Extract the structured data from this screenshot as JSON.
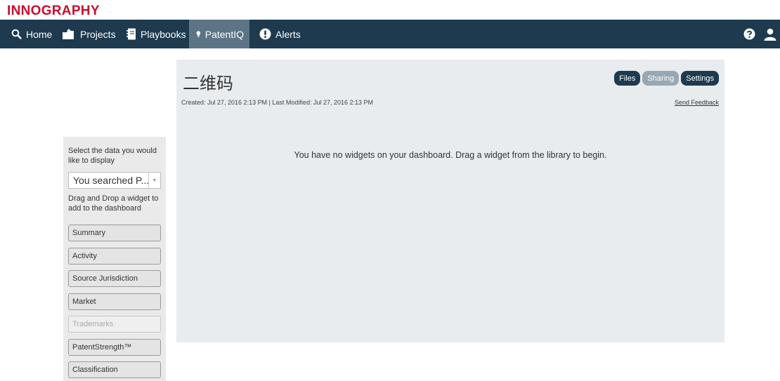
{
  "brand": "INNOGRAPHY",
  "nav": {
    "home": "Home",
    "projects": "Projects",
    "playbooks": "Playbooks",
    "patentiq": "PatentIQ",
    "alerts": "Alerts"
  },
  "dashboard": {
    "title": "二维码",
    "meta": "Created: Jul 27, 2016 2:13 PM | Last Modified: Jul 27, 2016 2:13 PM",
    "feedback": "Send Feedback",
    "buttons": {
      "files": "Files",
      "sharing": "Sharing",
      "settings": "Settings"
    },
    "empty_message": "You have no widgets on your dashboard. Drag a widget from the library to begin."
  },
  "sidebar": {
    "select_prompt": "Select the data you would like to display",
    "select_value": "You searched P...",
    "drag_prompt": "Drag and Drop a widget to add to the dashboard",
    "widgets": [
      {
        "label": "Summary",
        "enabled": true
      },
      {
        "label": "Activity",
        "enabled": true
      },
      {
        "label": "Source Jurisdiction",
        "enabled": true
      },
      {
        "label": "Market",
        "enabled": true
      },
      {
        "label": "Trademarks",
        "enabled": false
      },
      {
        "label": "PatentStrength™",
        "enabled": true
      },
      {
        "label": "Classification",
        "enabled": true
      }
    ]
  },
  "colors": {
    "brand": "#c8102e",
    "nav_bg": "#1d3a4e",
    "nav_active": "#5c7485",
    "panel_bg": "#e8ecef"
  }
}
